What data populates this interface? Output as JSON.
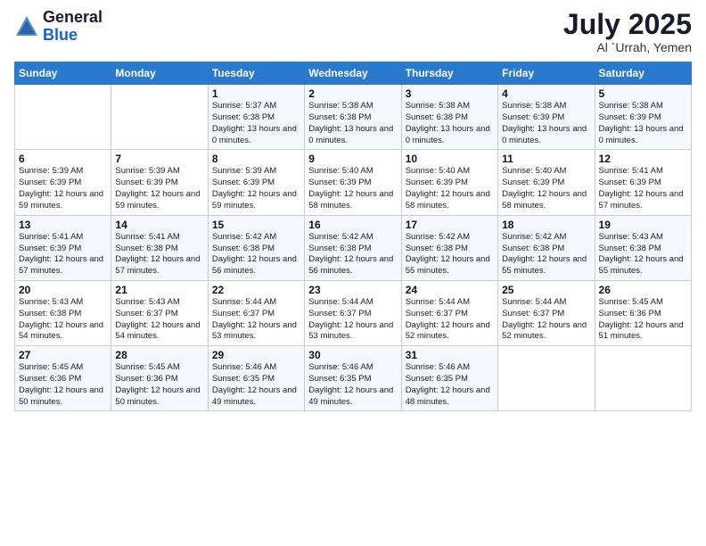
{
  "logo": {
    "general": "General",
    "blue": "Blue"
  },
  "header": {
    "month": "July 2025",
    "location": "Al `Urrah, Yemen"
  },
  "weekdays": [
    "Sunday",
    "Monday",
    "Tuesday",
    "Wednesday",
    "Thursday",
    "Friday",
    "Saturday"
  ],
  "weeks": [
    [
      {
        "day": "",
        "info": ""
      },
      {
        "day": "",
        "info": ""
      },
      {
        "day": "1",
        "info": "Sunrise: 5:37 AM\nSunset: 6:38 PM\nDaylight: 13 hours and 0 minutes."
      },
      {
        "day": "2",
        "info": "Sunrise: 5:38 AM\nSunset: 6:38 PM\nDaylight: 13 hours and 0 minutes."
      },
      {
        "day": "3",
        "info": "Sunrise: 5:38 AM\nSunset: 6:38 PM\nDaylight: 13 hours and 0 minutes."
      },
      {
        "day": "4",
        "info": "Sunrise: 5:38 AM\nSunset: 6:39 PM\nDaylight: 13 hours and 0 minutes."
      },
      {
        "day": "5",
        "info": "Sunrise: 5:38 AM\nSunset: 6:39 PM\nDaylight: 13 hours and 0 minutes."
      }
    ],
    [
      {
        "day": "6",
        "info": "Sunrise: 5:39 AM\nSunset: 6:39 PM\nDaylight: 12 hours and 59 minutes."
      },
      {
        "day": "7",
        "info": "Sunrise: 5:39 AM\nSunset: 6:39 PM\nDaylight: 12 hours and 59 minutes."
      },
      {
        "day": "8",
        "info": "Sunrise: 5:39 AM\nSunset: 6:39 PM\nDaylight: 12 hours and 59 minutes."
      },
      {
        "day": "9",
        "info": "Sunrise: 5:40 AM\nSunset: 6:39 PM\nDaylight: 12 hours and 58 minutes."
      },
      {
        "day": "10",
        "info": "Sunrise: 5:40 AM\nSunset: 6:39 PM\nDaylight: 12 hours and 58 minutes."
      },
      {
        "day": "11",
        "info": "Sunrise: 5:40 AM\nSunset: 6:39 PM\nDaylight: 12 hours and 58 minutes."
      },
      {
        "day": "12",
        "info": "Sunrise: 5:41 AM\nSunset: 6:39 PM\nDaylight: 12 hours and 57 minutes."
      }
    ],
    [
      {
        "day": "13",
        "info": "Sunrise: 5:41 AM\nSunset: 6:39 PM\nDaylight: 12 hours and 57 minutes."
      },
      {
        "day": "14",
        "info": "Sunrise: 5:41 AM\nSunset: 6:38 PM\nDaylight: 12 hours and 57 minutes."
      },
      {
        "day": "15",
        "info": "Sunrise: 5:42 AM\nSunset: 6:38 PM\nDaylight: 12 hours and 56 minutes."
      },
      {
        "day": "16",
        "info": "Sunrise: 5:42 AM\nSunset: 6:38 PM\nDaylight: 12 hours and 56 minutes."
      },
      {
        "day": "17",
        "info": "Sunrise: 5:42 AM\nSunset: 6:38 PM\nDaylight: 12 hours and 55 minutes."
      },
      {
        "day": "18",
        "info": "Sunrise: 5:42 AM\nSunset: 6:38 PM\nDaylight: 12 hours and 55 minutes."
      },
      {
        "day": "19",
        "info": "Sunrise: 5:43 AM\nSunset: 6:38 PM\nDaylight: 12 hours and 55 minutes."
      }
    ],
    [
      {
        "day": "20",
        "info": "Sunrise: 5:43 AM\nSunset: 6:38 PM\nDaylight: 12 hours and 54 minutes."
      },
      {
        "day": "21",
        "info": "Sunrise: 5:43 AM\nSunset: 6:37 PM\nDaylight: 12 hours and 54 minutes."
      },
      {
        "day": "22",
        "info": "Sunrise: 5:44 AM\nSunset: 6:37 PM\nDaylight: 12 hours and 53 minutes."
      },
      {
        "day": "23",
        "info": "Sunrise: 5:44 AM\nSunset: 6:37 PM\nDaylight: 12 hours and 53 minutes."
      },
      {
        "day": "24",
        "info": "Sunrise: 5:44 AM\nSunset: 6:37 PM\nDaylight: 12 hours and 52 minutes."
      },
      {
        "day": "25",
        "info": "Sunrise: 5:44 AM\nSunset: 6:37 PM\nDaylight: 12 hours and 52 minutes."
      },
      {
        "day": "26",
        "info": "Sunrise: 5:45 AM\nSunset: 6:36 PM\nDaylight: 12 hours and 51 minutes."
      }
    ],
    [
      {
        "day": "27",
        "info": "Sunrise: 5:45 AM\nSunset: 6:36 PM\nDaylight: 12 hours and 50 minutes."
      },
      {
        "day": "28",
        "info": "Sunrise: 5:45 AM\nSunset: 6:36 PM\nDaylight: 12 hours and 50 minutes."
      },
      {
        "day": "29",
        "info": "Sunrise: 5:46 AM\nSunset: 6:35 PM\nDaylight: 12 hours and 49 minutes."
      },
      {
        "day": "30",
        "info": "Sunrise: 5:46 AM\nSunset: 6:35 PM\nDaylight: 12 hours and 49 minutes."
      },
      {
        "day": "31",
        "info": "Sunrise: 5:46 AM\nSunset: 6:35 PM\nDaylight: 12 hours and 48 minutes."
      },
      {
        "day": "",
        "info": ""
      },
      {
        "day": "",
        "info": ""
      }
    ]
  ]
}
